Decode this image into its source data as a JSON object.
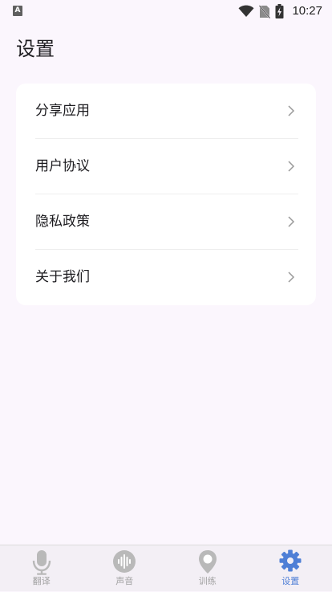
{
  "status_bar": {
    "app_icon_letter": "A",
    "time": "10:27"
  },
  "page": {
    "title": "设置"
  },
  "settings": {
    "items": [
      {
        "label": "分享应用"
      },
      {
        "label": "用户协议"
      },
      {
        "label": "隐私政策"
      },
      {
        "label": "关于我们"
      }
    ]
  },
  "bottom_nav": {
    "items": [
      {
        "label": "翻译",
        "icon": "microphone-icon",
        "active": false
      },
      {
        "label": "声音",
        "icon": "sound-wave-icon",
        "active": false
      },
      {
        "label": "训练",
        "icon": "location-pin-icon",
        "active": false
      },
      {
        "label": "设置",
        "icon": "gear-icon",
        "active": true
      }
    ],
    "active_color": "#4f7fd6",
    "inactive_color": "#a2a2a2"
  },
  "colors": {
    "background": "#fbf6fd",
    "card": "#ffffff"
  }
}
